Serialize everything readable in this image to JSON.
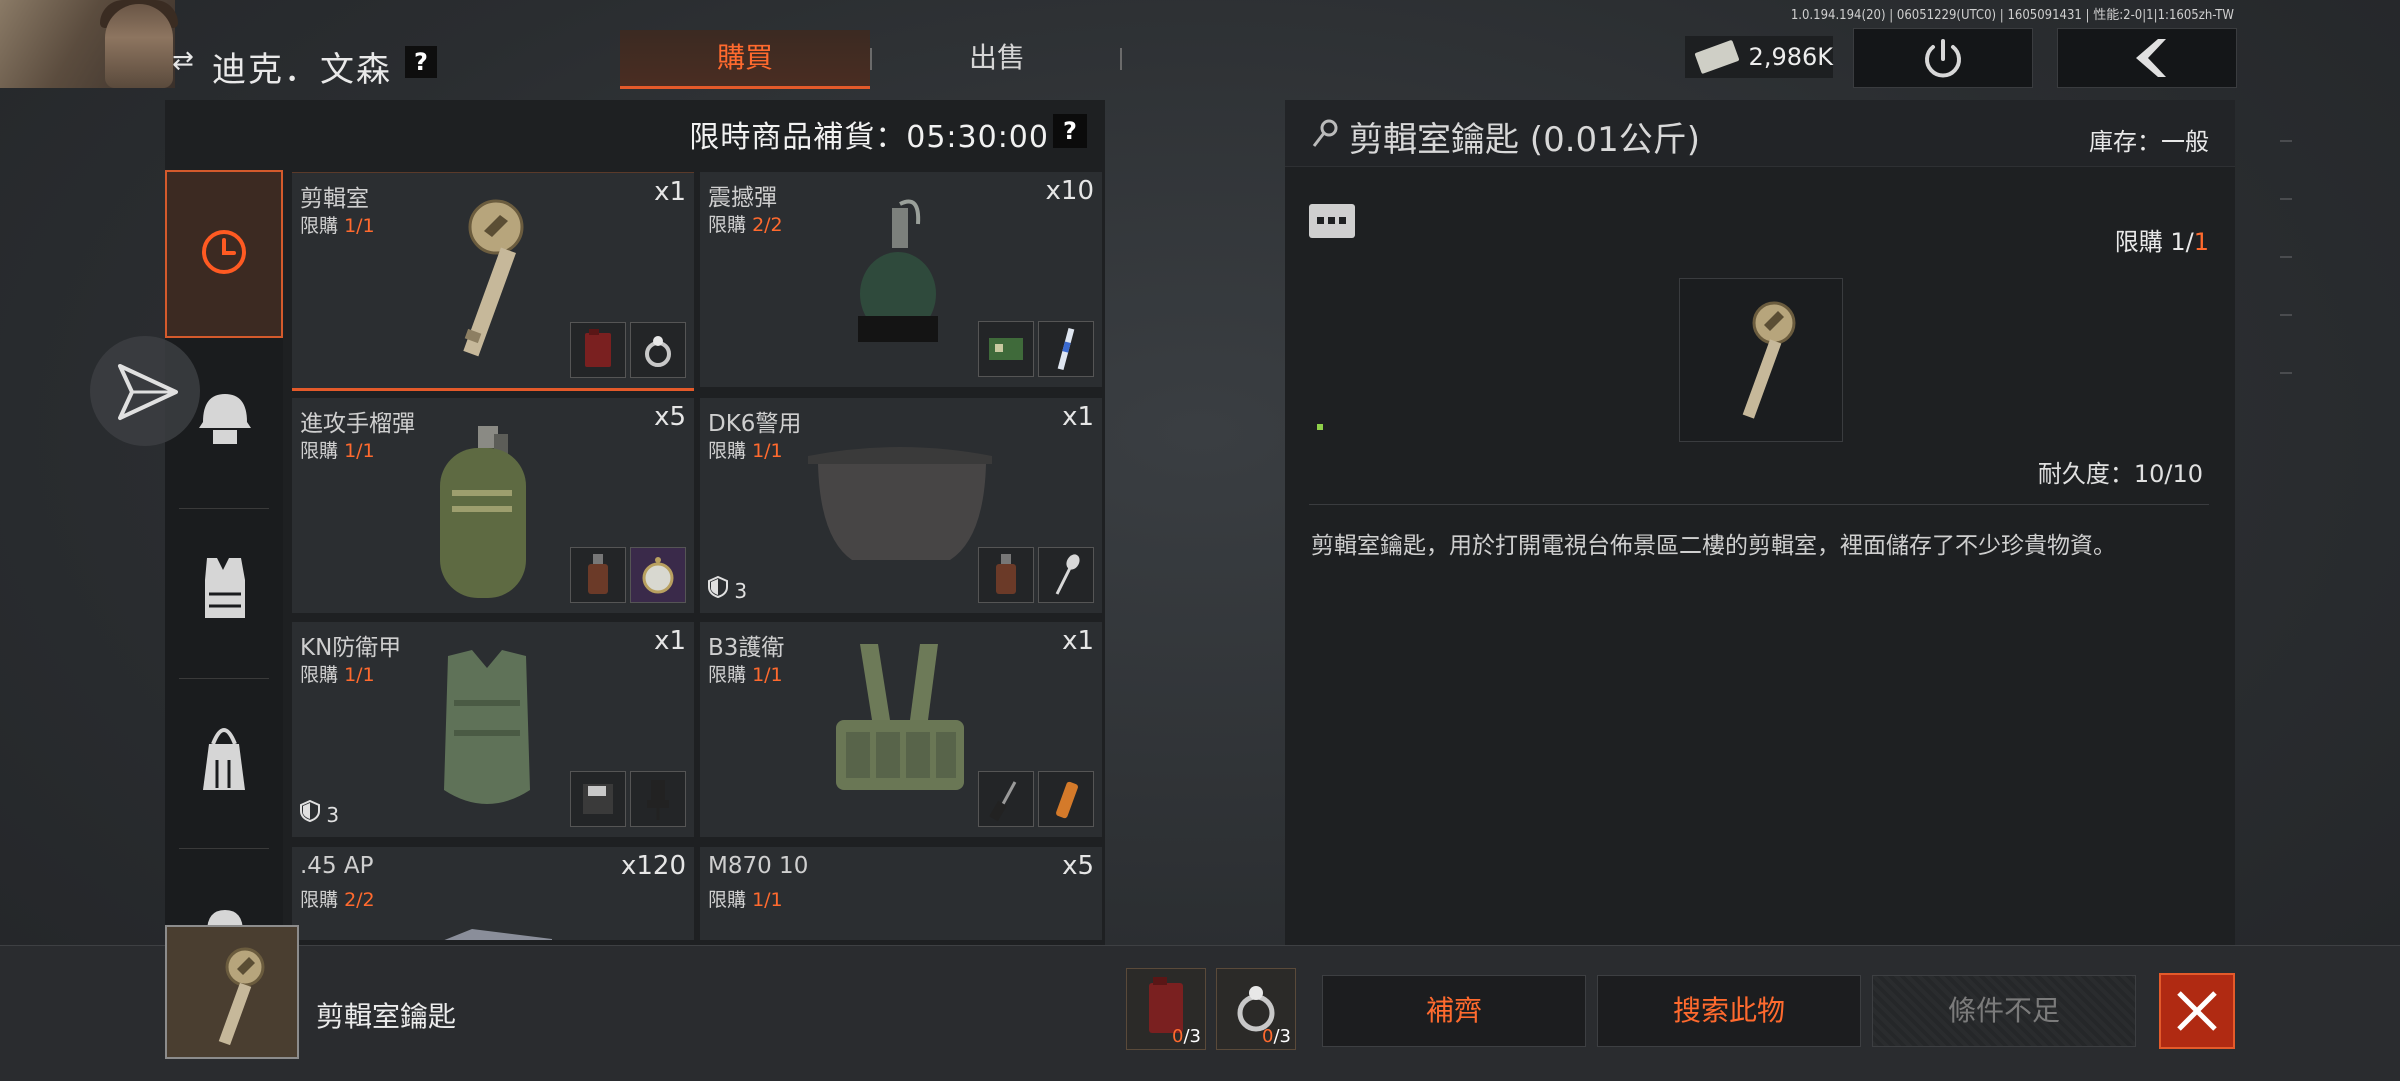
{
  "player": {
    "name": "迪克．文森",
    "help": "?"
  },
  "tabs": {
    "buy": "購買",
    "sell": "出售"
  },
  "version_info": "1.0.194.194(20) | 06051229(UTC0) | 1605091431 | 性能:2-0|1|1:1605zh-TW",
  "money": {
    "amount": "2,986K"
  },
  "restock": {
    "label": "限時商品補貨：05:30:00",
    "help": "?"
  },
  "nav": [
    "clock-icon",
    "helmet-icon",
    "vest-icon",
    "backpack-icon",
    "bag-icon"
  ],
  "items": [
    {
      "name": "剪輯室",
      "limit_label": "限購",
      "limit": "1/1",
      "qty": "x1",
      "req": [
        "fuel-can-icon",
        "ring-icon"
      ]
    },
    {
      "name": "震撼彈",
      "limit_label": "限購",
      "limit": "2/2",
      "qty": "x10",
      "req": [
        "circuit-board-icon",
        "syringe-icon"
      ]
    },
    {
      "name": "進攻手榴彈",
      "limit_label": "限購",
      "limit": "1/1",
      "qty": "x5",
      "req": [
        "bottle-icon",
        "pocket-watch-icon"
      ]
    },
    {
      "name": "DK6警用",
      "limit_label": "限購",
      "limit": "1/1",
      "qty": "x1",
      "armor": "3",
      "req": [
        "bottle-icon",
        "spoon-icon"
      ]
    },
    {
      "name": "KN防衛甲",
      "limit_label": "限購",
      "limit": "1/1",
      "qty": "x1",
      "armor": "3",
      "req": [
        "floppy-icon",
        "chair-icon"
      ]
    },
    {
      "name": "B3護衛",
      "limit_label": "限購",
      "limit": "1/1",
      "qty": "x1",
      "req": [
        "screwdriver-icon",
        "lighter-icon"
      ]
    },
    {
      "name": ".45 AP",
      "limit_label": "限購",
      "limit": "2/2",
      "qty": "x120"
    },
    {
      "name": "M870 10",
      "limit_label": "限購",
      "limit": "1/1",
      "qty": "x5"
    }
  ],
  "detail": {
    "title": "剪輯室鑰匙 (0.01公斤)",
    "stock": "庫存：一般",
    "limit_label": "限購",
    "limit_a": "1/",
    "limit_b": "1",
    "durability": "耐久度：10/10",
    "description": "剪輯室鑰匙，用於打開電視台佈景區二樓的剪輯室，裡面儲存了不少珍貴物資。"
  },
  "bottom": {
    "item_name": "剪輯室鑰匙",
    "materials": [
      {
        "have": "0",
        "need": "/3"
      },
      {
        "have": "0",
        "need": "/3"
      }
    ],
    "btn_supply": "補齊",
    "btn_search": "搜索此物",
    "btn_disabled": "條件不足"
  },
  "colors": {
    "accent": "#ff6a2e",
    "panel": "#1e2022",
    "card": "#2b2e31"
  }
}
